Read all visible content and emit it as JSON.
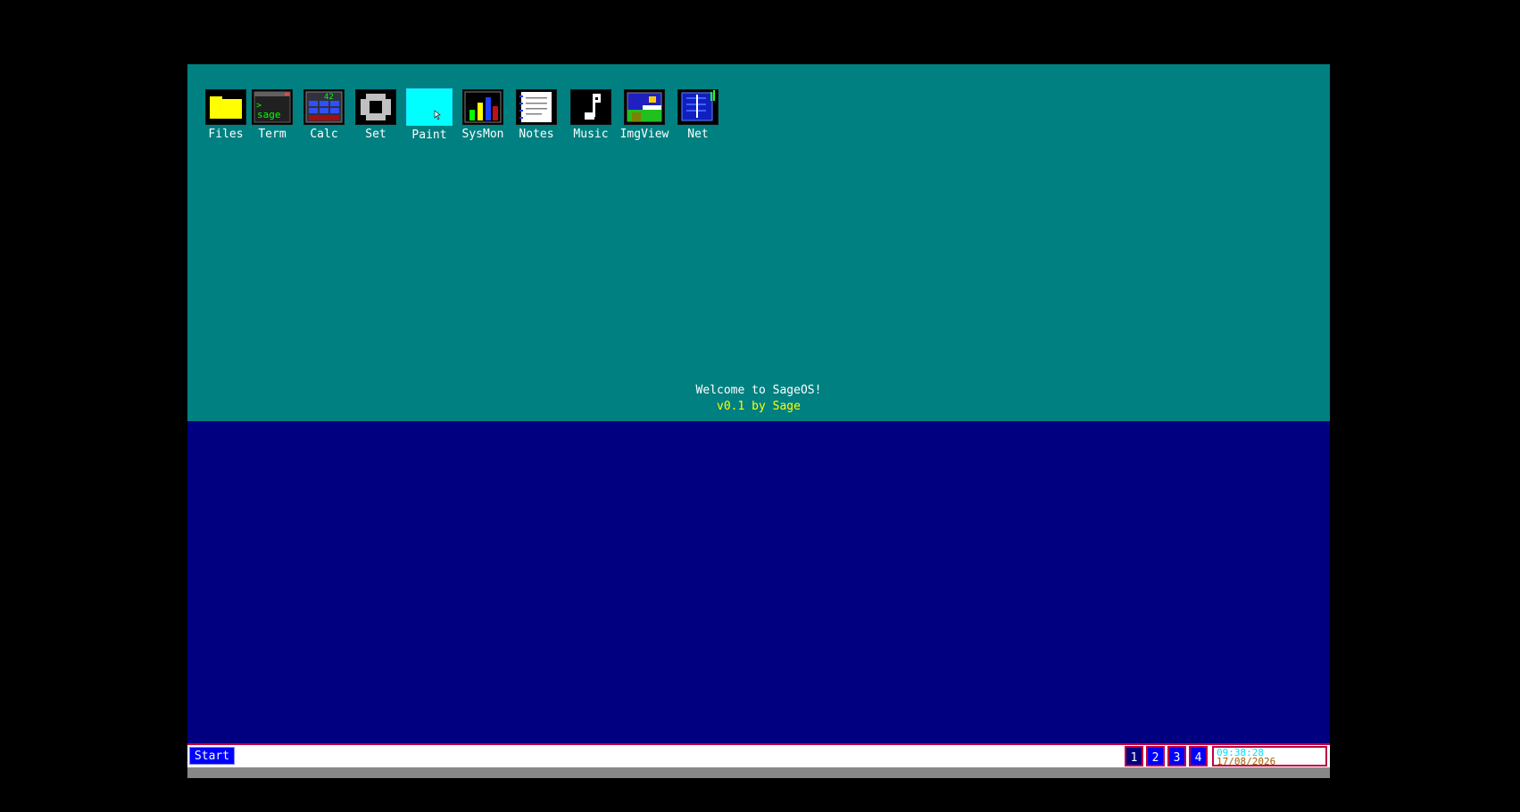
{
  "desktop": {
    "icons": [
      {
        "label": "Files",
        "icon": "folder-icon"
      },
      {
        "label": "Term",
        "icon": "terminal-icon",
        "glyph_text": "sage"
      },
      {
        "label": "Calc",
        "icon": "calculator-icon",
        "glyph_text": "42"
      },
      {
        "label": "Set",
        "icon": "gear-icon"
      },
      {
        "label": "Paint",
        "icon": "paint-icon",
        "selected": true
      },
      {
        "label": "SysMon",
        "icon": "bar-chart-icon"
      },
      {
        "label": "Notes",
        "icon": "notepad-icon"
      },
      {
        "label": "Music",
        "icon": "music-note-icon"
      },
      {
        "label": "ImgView",
        "icon": "image-icon"
      },
      {
        "label": "Net",
        "icon": "network-icon"
      }
    ],
    "welcome_line1": "Welcome to SageOS!",
    "welcome_line2": "v0.1 by Sage"
  },
  "taskbar": {
    "start_label": "Start",
    "workspaces": [
      "1",
      "2",
      "3",
      "4"
    ],
    "active_workspace": "1",
    "clock_time": "09:38:28",
    "clock_date": "17/08/2026"
  },
  "colors": {
    "desktop_bg": "#008080",
    "screen_bg": "#000080",
    "accent": "#c00040",
    "start_bg": "#0000ff",
    "welcome_version": "#ffff00"
  }
}
